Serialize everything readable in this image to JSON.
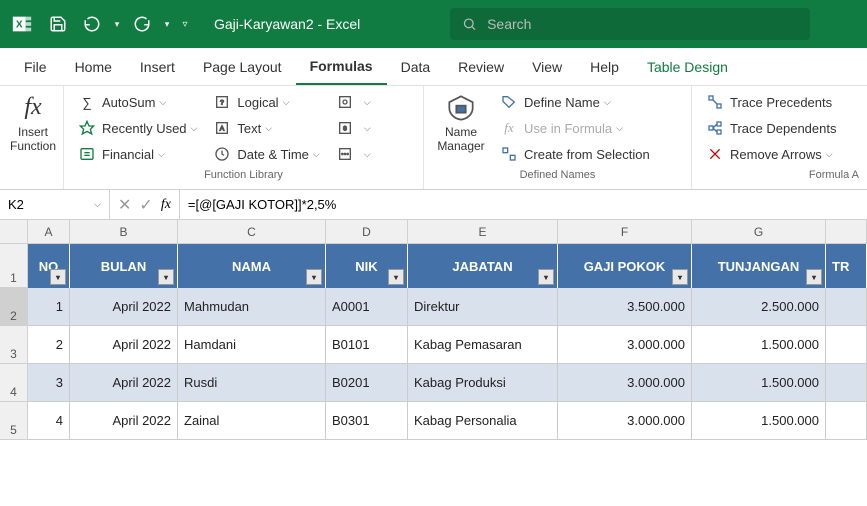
{
  "app": {
    "title": "Gaji-Karyawan2 - Excel"
  },
  "search": {
    "placeholder": "Search"
  },
  "tabs": [
    {
      "label": "File"
    },
    {
      "label": "Home"
    },
    {
      "label": "Insert"
    },
    {
      "label": "Page Layout"
    },
    {
      "label": "Formulas",
      "active": true
    },
    {
      "label": "Data"
    },
    {
      "label": "Review"
    },
    {
      "label": "View"
    },
    {
      "label": "Help"
    },
    {
      "label": "Table Design",
      "contextual": true
    }
  ],
  "ribbon": {
    "insert_fn": "Insert Function",
    "lib": {
      "autosum": "AutoSum",
      "recently": "Recently Used",
      "financial": "Financial",
      "logical": "Logical",
      "text": "Text",
      "datetime": "Date & Time",
      "label": "Function Library"
    },
    "names": {
      "manager": "Name Manager",
      "define": "Define Name",
      "usein": "Use in Formula",
      "create": "Create from Selection",
      "label": "Defined Names"
    },
    "audit": {
      "precedents": "Trace Precedents",
      "dependents": "Trace Dependents",
      "remove": "Remove Arrows",
      "label": "Formula A"
    }
  },
  "formula_bar": {
    "name_box": "K2",
    "formula": "=[@[GAJI KOTOR]]*2,5%"
  },
  "cols": [
    "A",
    "B",
    "C",
    "D",
    "E",
    "F",
    "G"
  ],
  "headers": [
    "NO",
    "BULAN",
    "NAMA",
    "NIK",
    "JABATAN",
    "GAJI POKOK",
    "TUNJANGAN",
    "TR"
  ],
  "rows": [
    {
      "no": "1",
      "bulan": "April 2022",
      "nama": "Mahmudan",
      "nik": "A0001",
      "jabatan": "Direktur",
      "gaji": "3.500.000",
      "tunj": "2.500.000"
    },
    {
      "no": "2",
      "bulan": "April 2022",
      "nama": "Hamdani",
      "nik": "B0101",
      "jabatan": "Kabag Pemasaran",
      "gaji": "3.000.000",
      "tunj": "1.500.000"
    },
    {
      "no": "3",
      "bulan": "April 2022",
      "nama": "Rusdi",
      "nik": "B0201",
      "jabatan": "Kabag Produksi",
      "gaji": "3.000.000",
      "tunj": "1.500.000"
    },
    {
      "no": "4",
      "bulan": "April 2022",
      "nama": "Zainal",
      "nik": "B0301",
      "jabatan": "Kabag Personalia",
      "gaji": "3.000.000",
      "tunj": "1.500.000"
    }
  ]
}
